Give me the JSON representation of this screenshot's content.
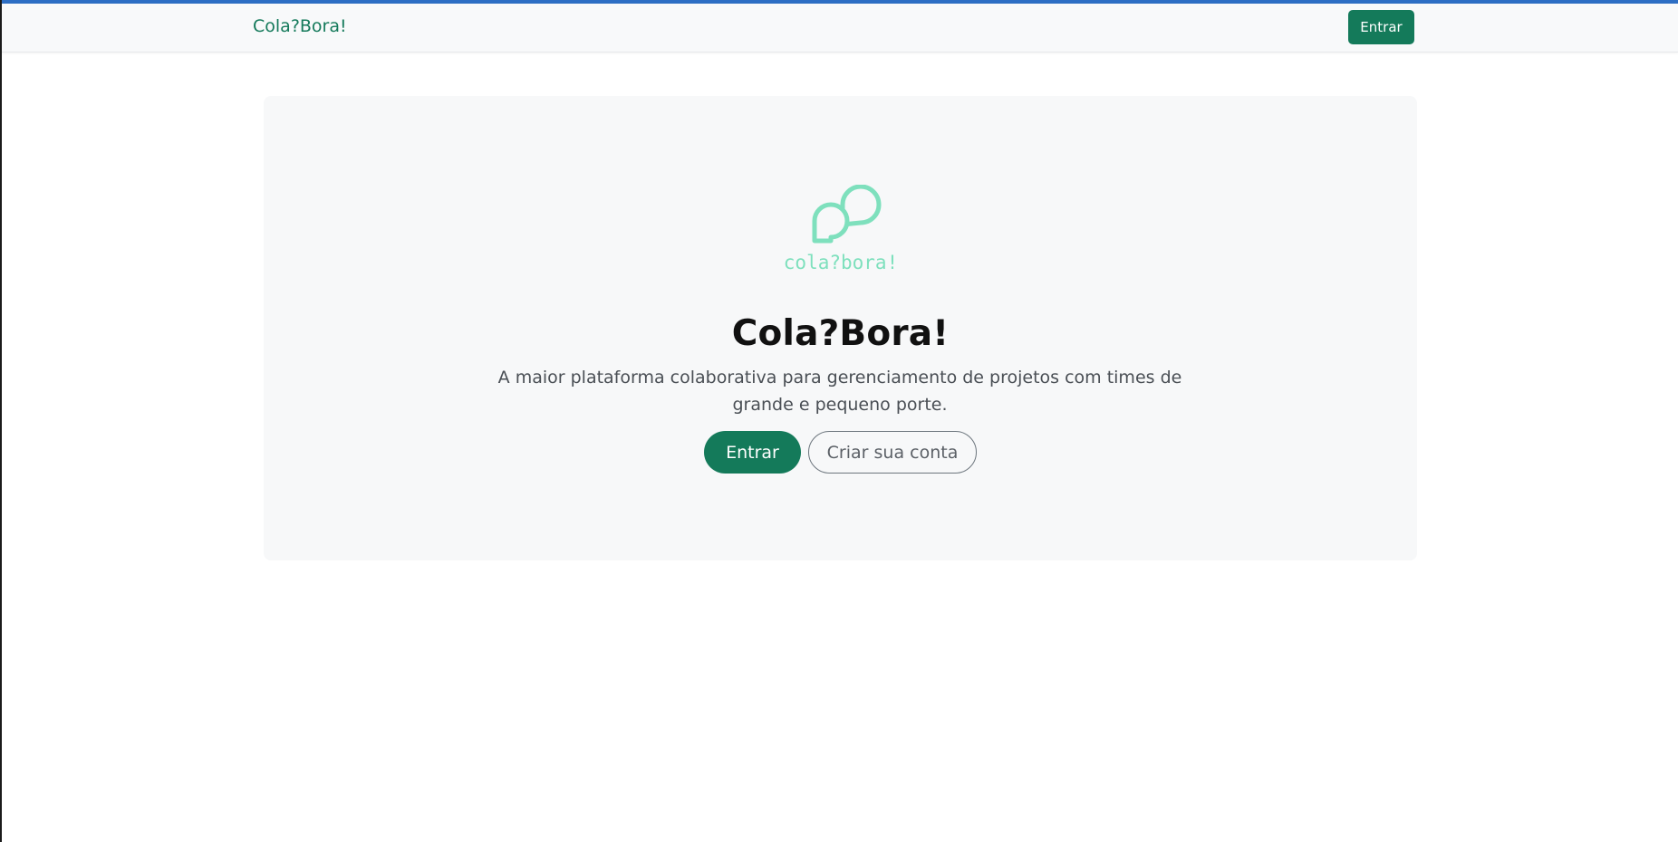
{
  "navbar": {
    "brand": "Cola?Bora!",
    "login_label": "Entrar"
  },
  "hero": {
    "logo_text": "cola?bora!",
    "title": "Cola?Bora!",
    "description": "A maior plataforma colaborativa para gerenciamento de projetos com times de grande e pequeno porte.",
    "primary_button": "Entrar",
    "secondary_button": "Criar sua conta"
  },
  "colors": {
    "brand_green": "#147a5a",
    "logo_mint": "#7ee0bd",
    "hero_bg": "#f7f8f9",
    "navbar_bg": "#f8f9fa"
  }
}
